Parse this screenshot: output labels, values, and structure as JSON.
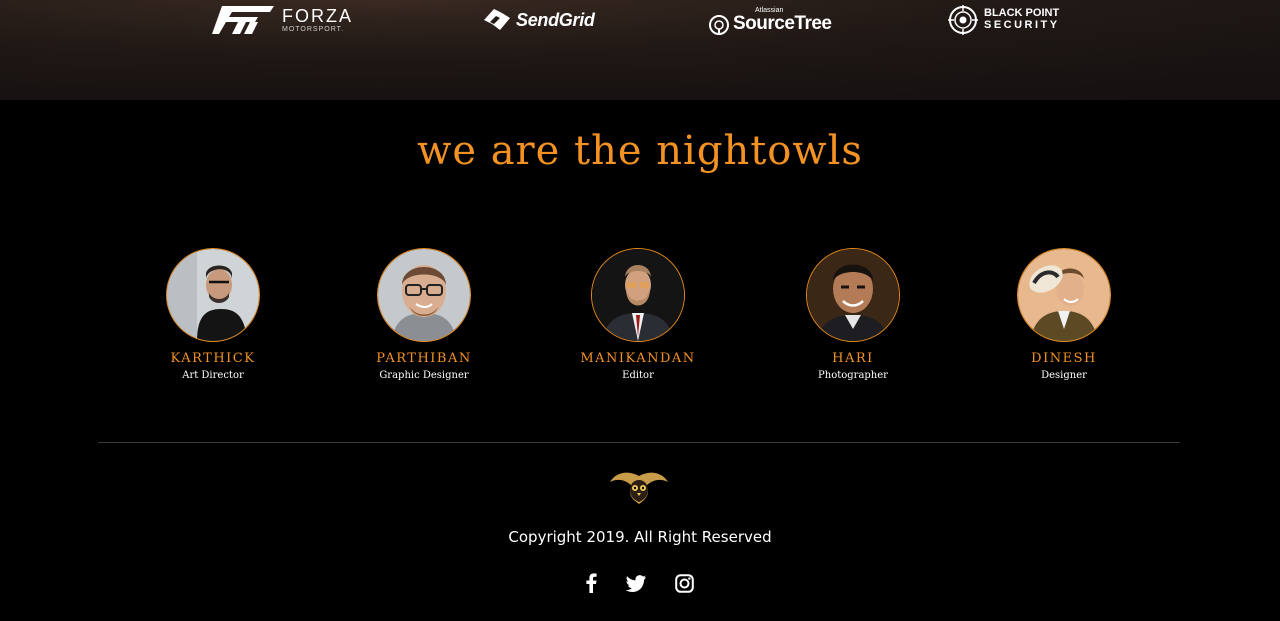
{
  "partners": [
    {
      "name": "FORZA",
      "sub": "MOTORSPORT.",
      "icon": "forza-logo-icon"
    },
    {
      "name": "SendGrid",
      "icon": "sendgrid-logo-icon"
    },
    {
      "pre": "Atlassian",
      "name": "SourceTree",
      "icon": "sourcetree-logo-icon"
    },
    {
      "name": "BLACK POINT",
      "sub": "SECURITY",
      "icon": "blackpoint-logo-icon"
    }
  ],
  "team": {
    "heading": "we are the nightowls",
    "members": [
      {
        "name": "KARTHICK",
        "role": "Art Director"
      },
      {
        "name": "PARTHIBAN",
        "role": "Graphic Designer"
      },
      {
        "name": "MANIKANDAN",
        "role": "Editor"
      },
      {
        "name": "HARI",
        "role": "Photographer"
      },
      {
        "name": "DINESH",
        "role": "Designer"
      }
    ]
  },
  "footer": {
    "logo_icon": "owl-logo-icon",
    "copyright": "Copyright 2019. All Right Reserved",
    "social": [
      "facebook-icon",
      "twitter-icon",
      "instagram-icon"
    ]
  },
  "colors": {
    "accent": "#f39222",
    "background": "#000000"
  }
}
